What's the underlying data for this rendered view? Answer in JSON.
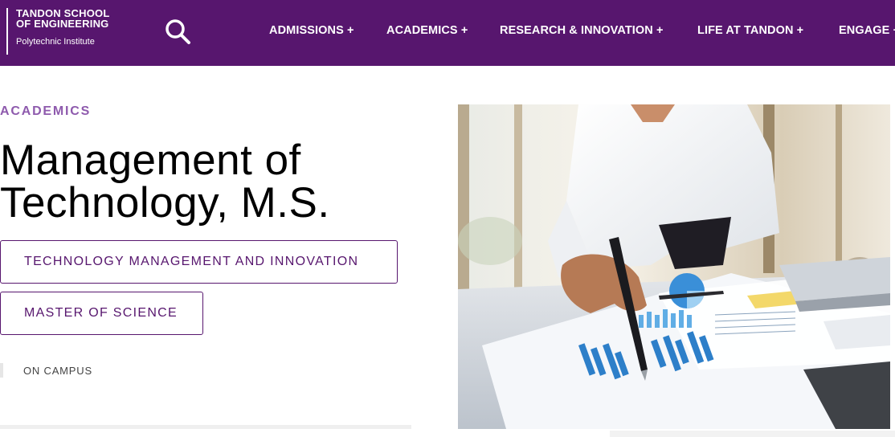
{
  "header": {
    "logo": {
      "line1": "TANDON SCHOOL",
      "line2": "OF ENGINEERING",
      "line3": "Polytechnic Institute"
    },
    "search_icon": "search-icon",
    "nav": [
      {
        "label": "ADMISSIONS +"
      },
      {
        "label": "ACADEMICS +"
      },
      {
        "label": "RESEARCH & INNOVATION +"
      },
      {
        "label": "LIFE AT TANDON +"
      },
      {
        "label": "ENGAGE +"
      }
    ]
  },
  "main": {
    "eyebrow": "ACADEMICS",
    "title_line1": "Management of",
    "title_line2": "Technology, M.S.",
    "tags": [
      {
        "label": "TECHNOLOGY MANAGEMENT AND INNOVATION"
      },
      {
        "label": "MASTER OF SCIENCE"
      }
    ],
    "location": "ON CAMPUS"
  },
  "colors": {
    "brand_purple": "#57166e",
    "eyebrow_purple": "#8e5aad"
  }
}
